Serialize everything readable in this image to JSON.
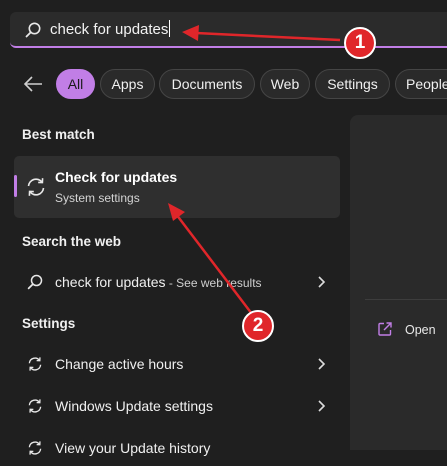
{
  "search": {
    "query": "check for updates"
  },
  "filters": {
    "chips": [
      "All",
      "Apps",
      "Documents",
      "Web",
      "Settings",
      "People"
    ],
    "active": "All"
  },
  "best_match": {
    "heading": "Best match",
    "title": "Check for updates",
    "subtitle": "System settings"
  },
  "web": {
    "heading": "Search the web",
    "query": "check for updates",
    "suffix": " - See web results"
  },
  "settings": {
    "heading": "Settings",
    "items": [
      "Change active hours",
      "Windows Update settings",
      "View your Update history"
    ]
  },
  "preview": {
    "open_label": "Open"
  },
  "annotations": {
    "step1": "1",
    "step2": "2"
  },
  "colors": {
    "accent": "#c17ee6",
    "annotation": "#e0262a",
    "background": "#1f1f1f"
  },
  "icons": [
    "search-icon",
    "back-arrow-icon",
    "sync-icon",
    "chevron-right-icon",
    "open-external-icon"
  ]
}
